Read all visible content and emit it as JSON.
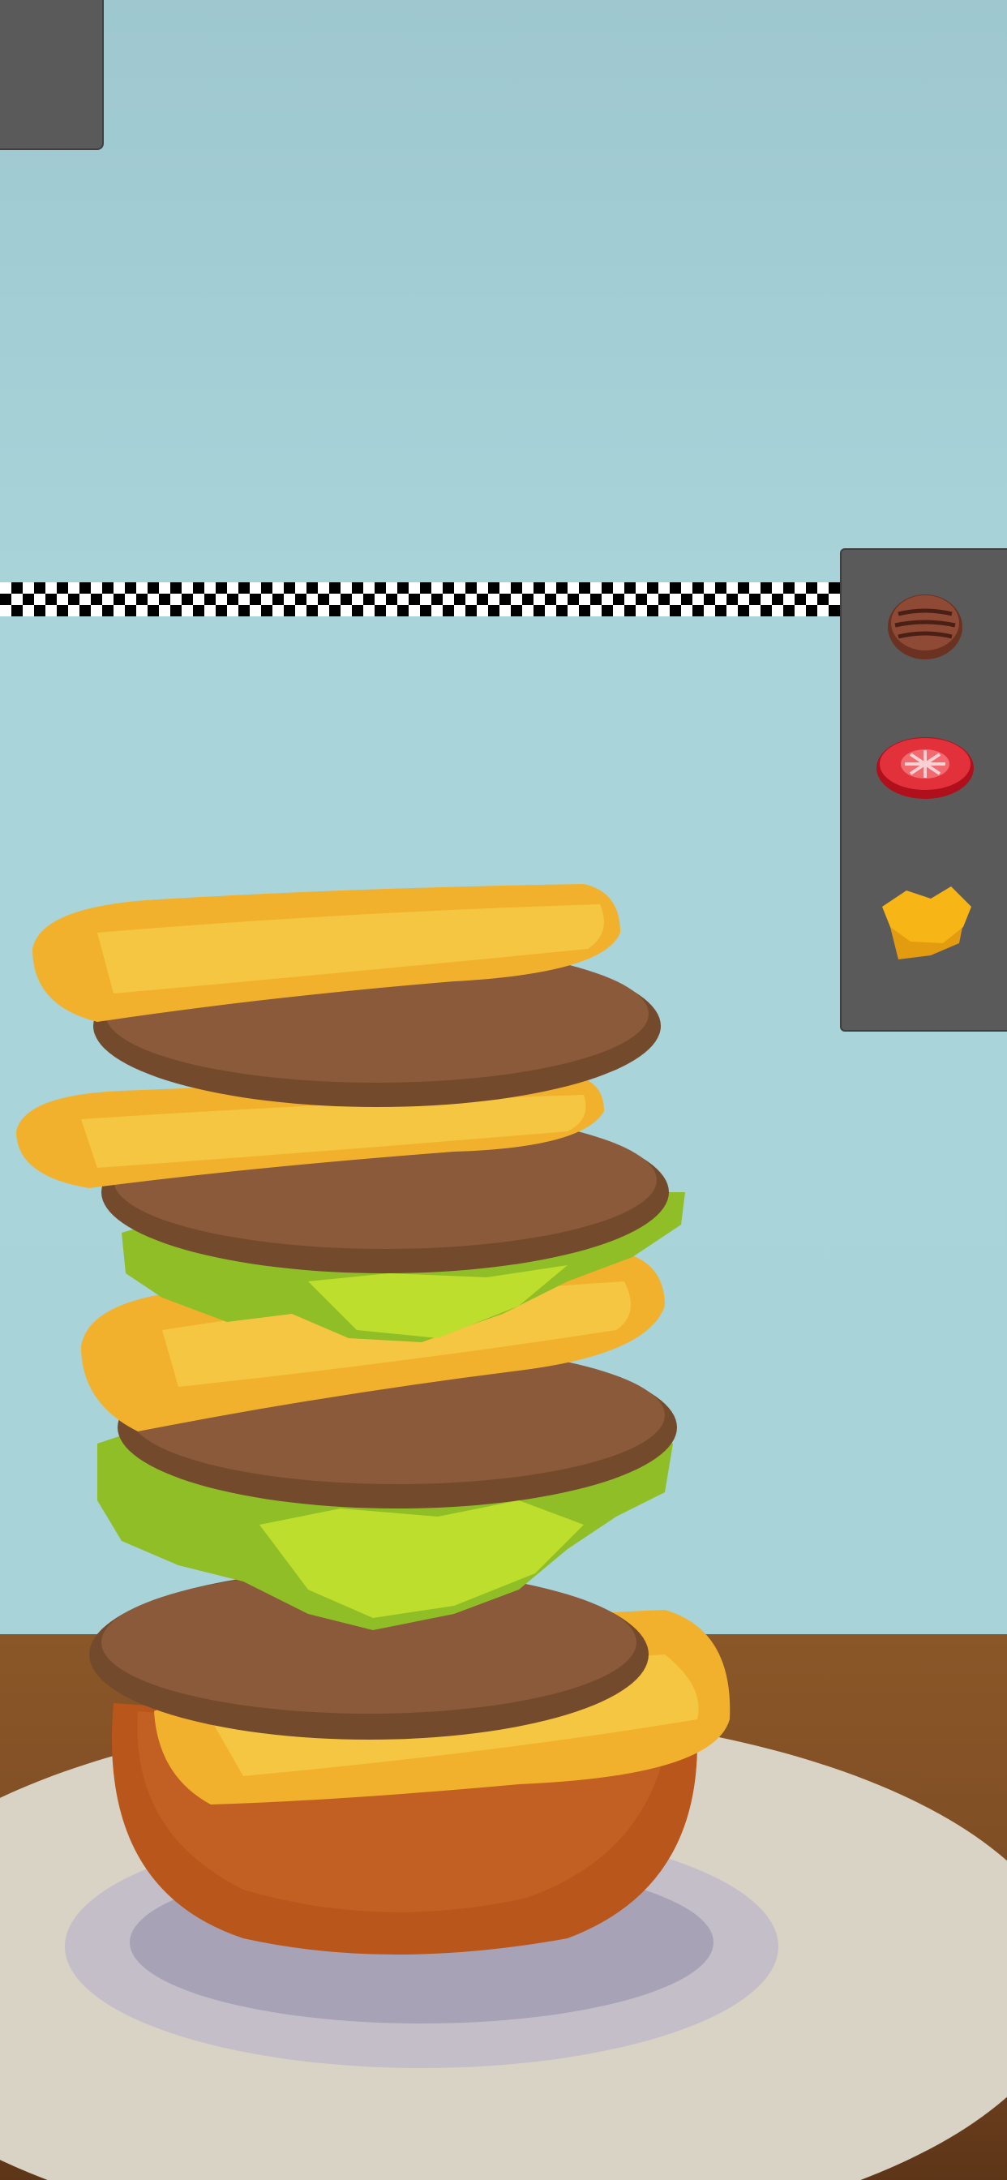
{
  "scene": {
    "title": "",
    "colors": {
      "sky": "#a9d5da",
      "table": "#7d4c23",
      "plate": "#d8d2c4",
      "bun": "#b9581c",
      "patty": "#7a4a2c",
      "cheese": "#f2b12c",
      "lettuce": "#9ccf2a",
      "tomato": "#d8202a"
    }
  },
  "corner_button": {
    "icon": "menu-button-blank"
  },
  "finish_line": {
    "pattern": "checkered"
  },
  "ingredients_panel": {
    "items": [
      {
        "name": "patty",
        "icon": "patty-icon"
      },
      {
        "name": "tomato",
        "icon": "tomato-icon"
      },
      {
        "name": "cheese",
        "icon": "cheese-icon"
      }
    ]
  },
  "burger_stack": {
    "layers_bottom_to_top": [
      "bun",
      "cheese",
      "patty",
      "lettuce",
      "patty",
      "cheese",
      "lettuce",
      "patty",
      "cheese",
      "patty",
      "cheese"
    ]
  }
}
